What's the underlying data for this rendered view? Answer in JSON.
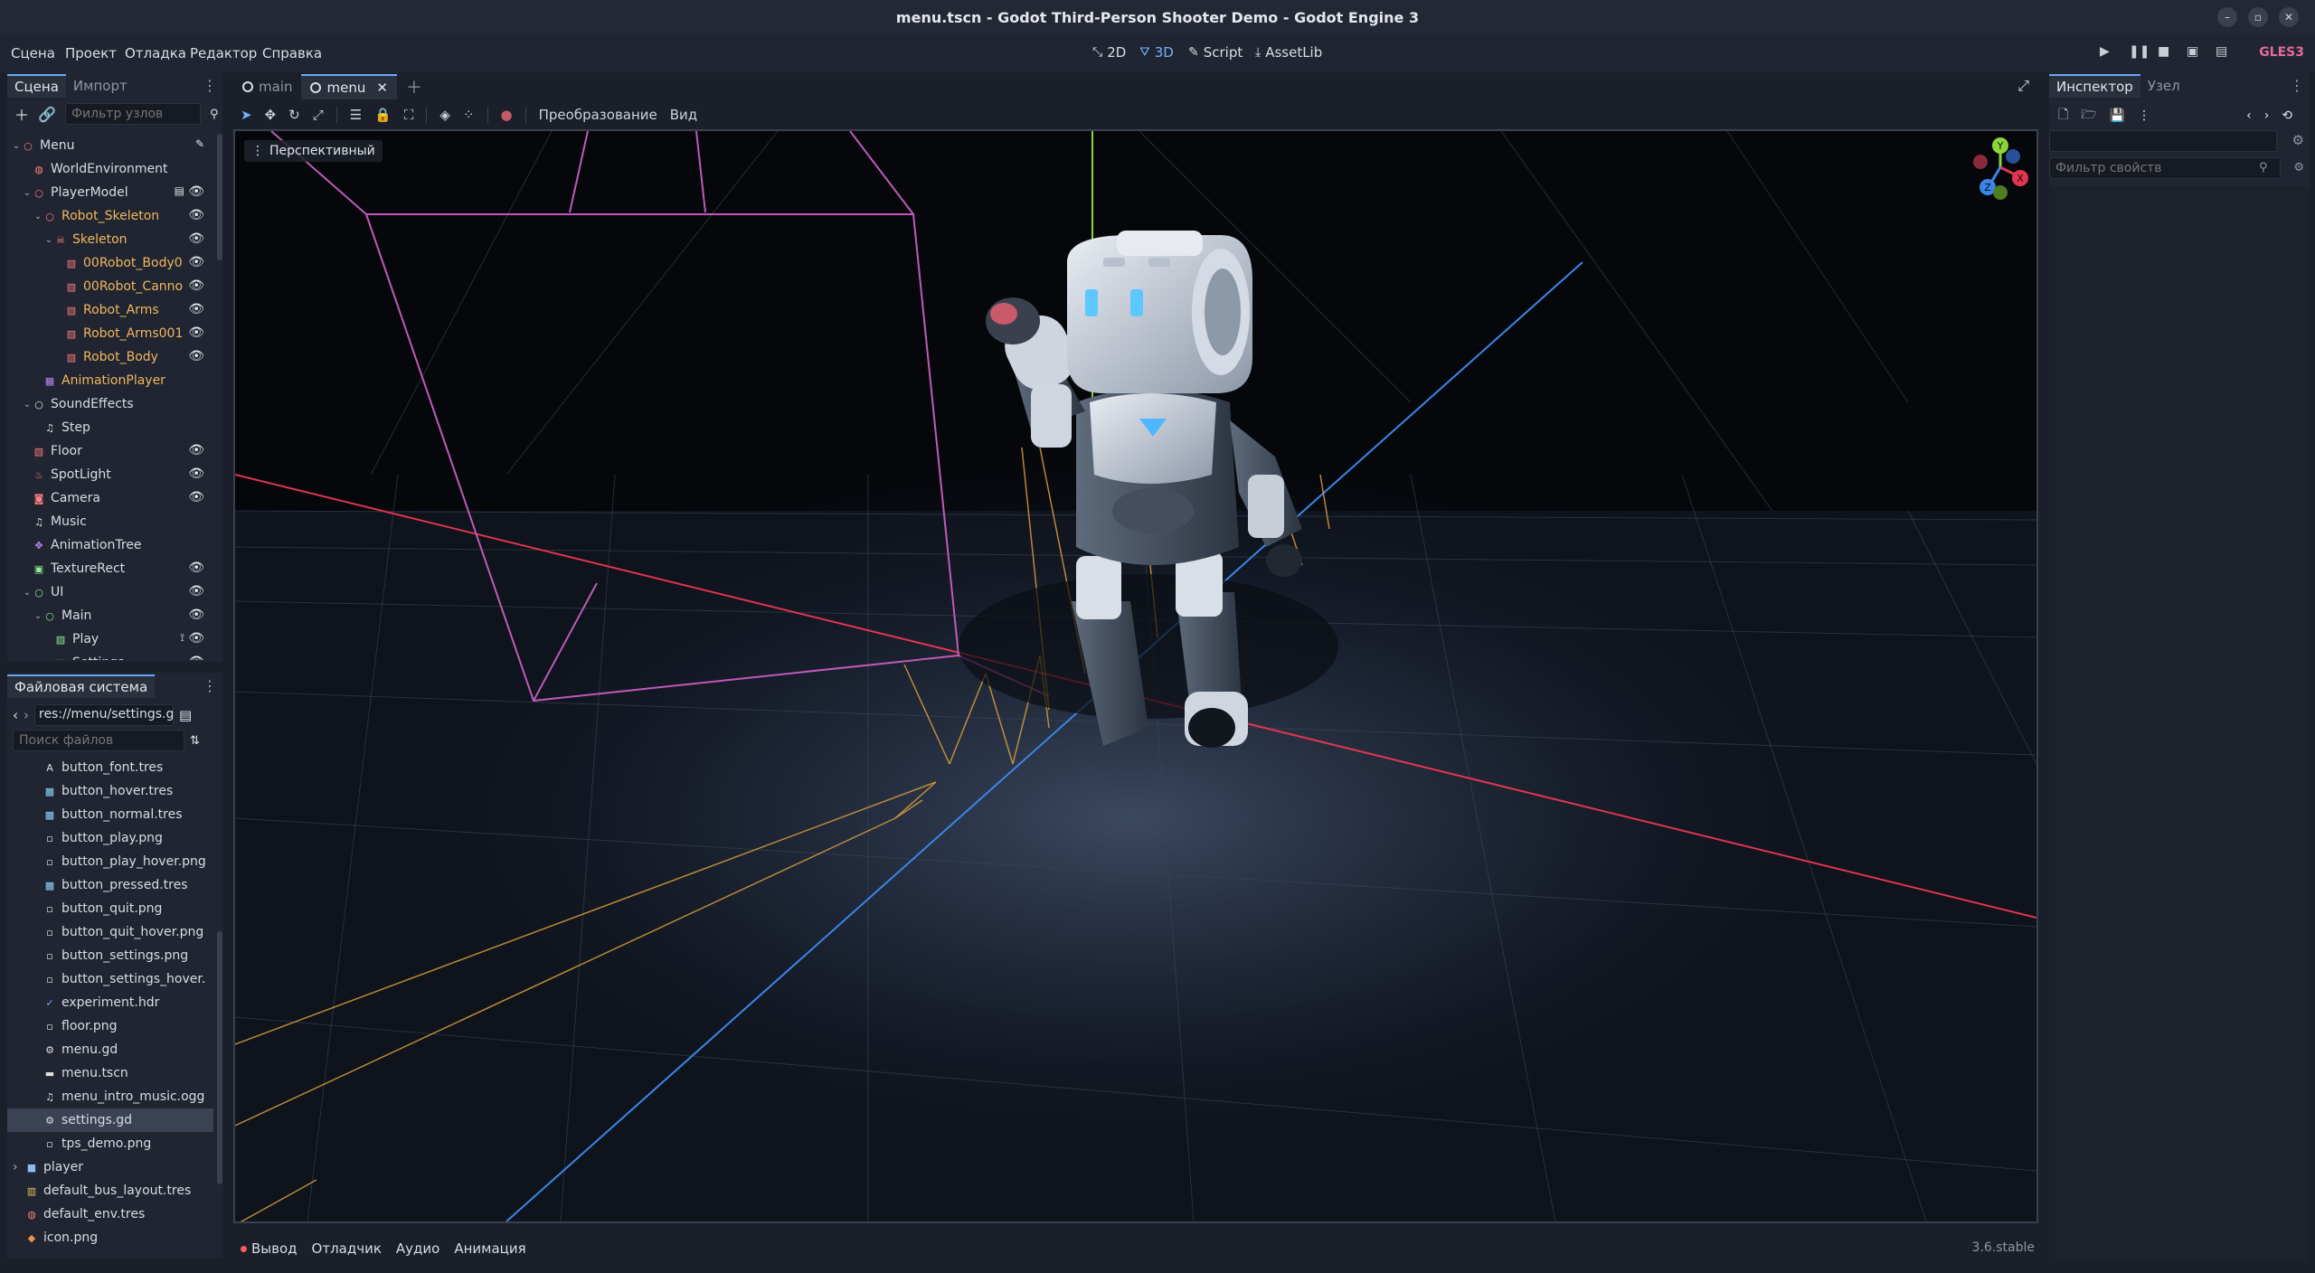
{
  "window": {
    "title": "menu.tscn - Godot Third-Person Shooter Demo - Godot Engine 3",
    "controls": [
      "–",
      "▫",
      "✕"
    ]
  },
  "menubar": {
    "items": [
      "Сцена",
      "Проект",
      "Отладка",
      "Редактор",
      "Справка"
    ],
    "workspaces": [
      "2D",
      "3D",
      "Script",
      "AssetLib"
    ],
    "active_workspace": "3D",
    "renderer": "GLES3"
  },
  "scene_panel": {
    "tabs": [
      "Сцена",
      "Импорт"
    ],
    "filter_placeholder": "Фильтр узлов",
    "nodes": [
      {
        "depth": 0,
        "label": "Menu",
        "expand": "v",
        "icon": "node3d",
        "extra": "script"
      },
      {
        "depth": 1,
        "label": "WorldEnvironment",
        "icon": "world-env"
      },
      {
        "depth": 1,
        "label": "PlayerModel",
        "expand": "v",
        "icon": "node3d",
        "eye": true,
        "extra": "film"
      },
      {
        "depth": 2,
        "label": "Robot_Skeleton",
        "expand": "v",
        "icon": "node3d",
        "eye": true,
        "orange": true
      },
      {
        "depth": 3,
        "label": "Skeleton",
        "expand": "v",
        "icon": "skeleton",
        "eye": true,
        "orange": true
      },
      {
        "depth": 4,
        "label": "00Robot_Body0",
        "icon": "mesh",
        "eye": true,
        "orange": true
      },
      {
        "depth": 4,
        "label": "00Robot_Canno",
        "icon": "mesh",
        "eye": true,
        "orange": true
      },
      {
        "depth": 4,
        "label": "Robot_Arms",
        "icon": "mesh",
        "eye": true,
        "orange": true
      },
      {
        "depth": 4,
        "label": "Robot_Arms001",
        "icon": "mesh",
        "eye": true,
        "orange": true
      },
      {
        "depth": 4,
        "label": "Robot_Body",
        "icon": "mesh",
        "eye": true,
        "orange": true
      },
      {
        "depth": 2,
        "label": "AnimationPlayer",
        "icon": "anim-player",
        "orange": true
      },
      {
        "depth": 1,
        "label": "SoundEffects",
        "expand": "v",
        "icon": "node"
      },
      {
        "depth": 2,
        "label": "Step",
        "icon": "audio"
      },
      {
        "depth": 1,
        "label": "Floor",
        "icon": "mesh",
        "eye": true
      },
      {
        "depth": 1,
        "label": "SpotLight",
        "icon": "light",
        "eye": true
      },
      {
        "depth": 1,
        "label": "Camera",
        "icon": "camera",
        "eye": true
      },
      {
        "depth": 1,
        "label": "Music",
        "icon": "audio"
      },
      {
        "depth": 1,
        "label": "AnimationTree",
        "icon": "anim-tree"
      },
      {
        "depth": 1,
        "label": "TextureRect",
        "icon": "texture-rect",
        "eye": true
      },
      {
        "depth": 1,
        "label": "UI",
        "expand": "v",
        "icon": "control",
        "eye": true
      },
      {
        "depth": 2,
        "label": "Main",
        "expand": "v",
        "icon": "control",
        "eye": true
      },
      {
        "depth": 3,
        "label": "Play",
        "icon": "texture-button",
        "eye": true,
        "extra": "signal"
      },
      {
        "depth": 3,
        "label": "Settings",
        "icon": "texture-button",
        "eye": true
      }
    ]
  },
  "filesystem": {
    "tab": "Файловая система",
    "path": "res://menu/settings.g",
    "search_placeholder": "Поиск файлов",
    "files": [
      {
        "name": "button_font.tres",
        "depth": 1,
        "icon": "font"
      },
      {
        "name": "button_hover.tres",
        "depth": 1,
        "icon": "style"
      },
      {
        "name": "button_normal.tres",
        "depth": 1,
        "icon": "style"
      },
      {
        "name": "button_play.png",
        "depth": 1,
        "icon": "image"
      },
      {
        "name": "button_play_hover.png",
        "depth": 1,
        "icon": "image"
      },
      {
        "name": "button_pressed.tres",
        "depth": 1,
        "icon": "style"
      },
      {
        "name": "button_quit.png",
        "depth": 1,
        "icon": "image"
      },
      {
        "name": "button_quit_hover.png",
        "depth": 1,
        "icon": "image"
      },
      {
        "name": "button_settings.png",
        "depth": 1,
        "icon": "image"
      },
      {
        "name": "button_settings_hover.",
        "depth": 1,
        "icon": "image"
      },
      {
        "name": "experiment.hdr",
        "depth": 1,
        "icon": "hdr"
      },
      {
        "name": "floor.png",
        "depth": 1,
        "icon": "image"
      },
      {
        "name": "menu.gd",
        "depth": 1,
        "icon": "gear"
      },
      {
        "name": "menu.tscn",
        "depth": 1,
        "icon": "scene"
      },
      {
        "name": "menu_intro_music.ogg",
        "depth": 1,
        "icon": "audio"
      },
      {
        "name": "settings.gd",
        "depth": 1,
        "icon": "gear",
        "selected": true
      },
      {
        "name": "tps_demo.png",
        "depth": 1,
        "icon": "image"
      },
      {
        "name": "player",
        "depth": 0,
        "icon": "folder",
        "expand": ">"
      },
      {
        "name": "default_bus_layout.tres",
        "depth": 0,
        "icon": "bus"
      },
      {
        "name": "default_env.tres",
        "depth": 0,
        "icon": "world-env"
      },
      {
        "name": "icon.png",
        "depth": 0,
        "icon": "godot"
      }
    ]
  },
  "editor": {
    "tabs": [
      "main",
      "menu"
    ],
    "active_tab": "menu",
    "viewport_toolbar": {
      "transform_menu": "Преобразование",
      "view_menu": "Вид"
    },
    "perspective_label": "Перспективный",
    "gizmo_axes": [
      "Y",
      "X",
      "Z"
    ]
  },
  "bottom_panel": {
    "tabs": [
      "Вывод",
      "Отладчик",
      "Аудио",
      "Анимация"
    ],
    "version": "3.6.stable"
  },
  "inspector": {
    "tabs": [
      "Инспектор",
      "Узел"
    ],
    "filter_placeholder": "Фильтр свойств"
  },
  "colors": {
    "accent": "#6aa7f8",
    "orange_nodes": "#f0b75f",
    "renderer": "#e36c9a",
    "x_axis": "#e0364f",
    "y_axis": "#88d63a",
    "z_axis": "#3a86e8"
  }
}
